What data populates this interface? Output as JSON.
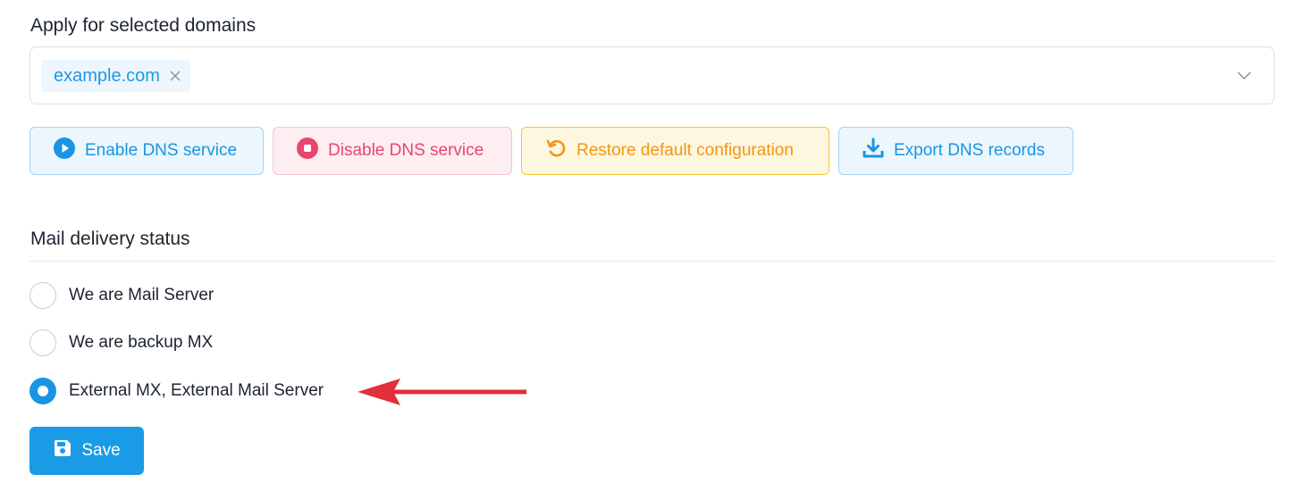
{
  "domains": {
    "title": "Apply for selected domains",
    "selected_tag": "example.com",
    "remove_icon": "close-icon",
    "dropdown_icon": "chevron-down-icon"
  },
  "actions": {
    "enable": {
      "label": "Enable DNS service",
      "icon": "play-circle-icon",
      "color": "#1a95e3"
    },
    "disable": {
      "label": "Disable DNS service",
      "icon": "stop-circle-icon",
      "color": "#e9466a"
    },
    "restore": {
      "label": "Restore default configuration",
      "icon": "undo-icon",
      "color": "#f29614"
    },
    "export": {
      "label": "Export DNS records",
      "icon": "download-icon",
      "color": "#1a95e3"
    }
  },
  "mail_delivery": {
    "title": "Mail delivery status",
    "options": [
      {
        "label": "We are Mail Server",
        "selected": false
      },
      {
        "label": "We are backup MX",
        "selected": false
      },
      {
        "label": "External MX, External Mail Server",
        "selected": true
      }
    ]
  },
  "annotation": {
    "icon": "arrow-left-icon",
    "color": "#e0303a"
  },
  "save": {
    "label": "Save",
    "icon": "save-icon",
    "color": "#1a9be6"
  }
}
